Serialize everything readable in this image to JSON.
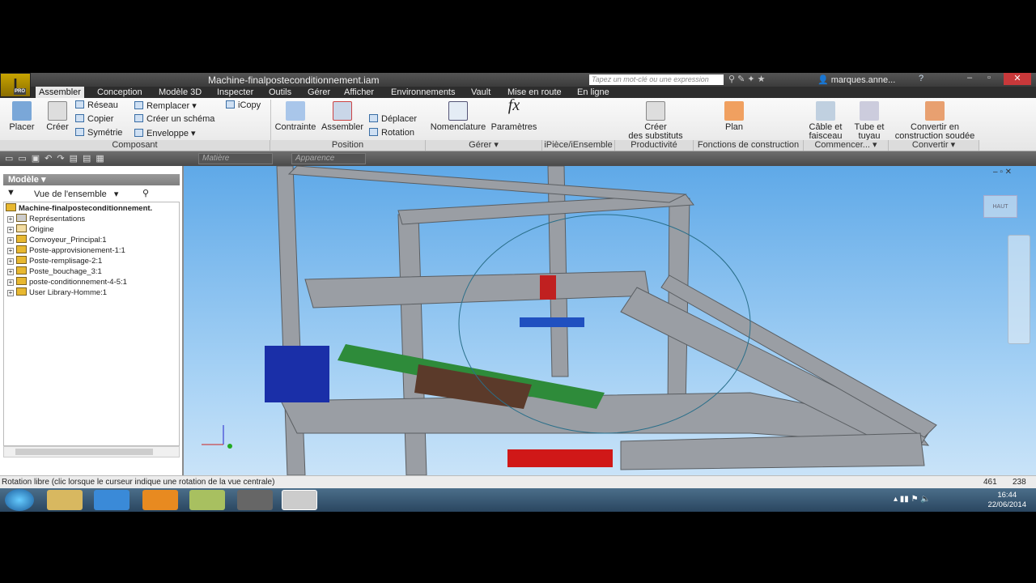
{
  "window": {
    "title": "Machine-finalposteconditionnement.iam",
    "search_placeholder": "Tapez un mot-clé ou une expression",
    "user": "marques.anne...",
    "logo": "PRO"
  },
  "tabs": [
    "Assembler",
    "Conception",
    "Modèle 3D",
    "Inspecter",
    "Outils",
    "Gérer",
    "Afficher",
    "Environnements",
    "Vault",
    "Mise en route",
    "En ligne"
  ],
  "ribbon": {
    "composant": {
      "label": "Composant",
      "placer": "Placer",
      "creer": "Créer",
      "reseau": "Réseau",
      "copier": "Copier",
      "symetrie": "Symétrie",
      "remplacer": "Remplacer",
      "creer_schema": "Créer un schéma",
      "enveloppe": "Enveloppe",
      "icopy": "iCopy"
    },
    "position": {
      "label": "Position",
      "contrainte": "Contrainte",
      "assembler": "Assembler",
      "deplacer": "Déplacer",
      "rotation": "Rotation"
    },
    "gerer": {
      "label": "Gérer",
      "nomenclature": "Nomenclature",
      "parametres": "Paramètres"
    },
    "ipiece": {
      "label": "iPièce/iEnsemble"
    },
    "productivite": {
      "label": "Productivité",
      "creer1": "Créer",
      "creer2": "des substituts"
    },
    "fonctions": {
      "label": "Fonctions de construction",
      "plan": "Plan"
    },
    "commencer": {
      "label": "Commencer...",
      "cable1": "Câble et",
      "cable2": "faisceau",
      "tube1": "Tube et",
      "tube2": "tuyau"
    },
    "convertir": {
      "label": "Convertir",
      "c1": "Convertir en",
      "c2": "construction soudée"
    }
  },
  "qat": {
    "material": "Matière",
    "appearance": "Apparence"
  },
  "browser": {
    "header": "Modèle",
    "view": "Vue de l'ensemble",
    "root": "Machine-finalposteconditionnement.",
    "items": [
      "Représentations",
      "Origine",
      "Convoyeur_Principal:1",
      "Poste-approvisionement-1:1",
      "Poste-remplisage-2:1",
      "Poste_bouchage_3:1",
      "poste-conditionnement-4-5:1",
      "User Library-Homme:1"
    ]
  },
  "status": {
    "text": "Rotation libre (clic lorsque le curseur indique une rotation de la vue centrale)",
    "x": "461",
    "y": "238"
  },
  "taskbar": {
    "time": "16:44",
    "date": "22/06/2014"
  },
  "viewcube": {
    "label": "HAUT"
  }
}
